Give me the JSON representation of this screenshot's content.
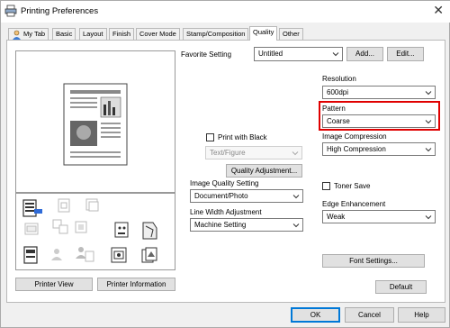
{
  "window": {
    "title": "Printing Preferences",
    "close_glyph": "✕"
  },
  "tabs": [
    {
      "label": "My Tab"
    },
    {
      "label": "Basic"
    },
    {
      "label": "Layout"
    },
    {
      "label": "Finish"
    },
    {
      "label": "Cover Mode"
    },
    {
      "label": "Stamp/Composition"
    },
    {
      "label": "Quality"
    },
    {
      "label": "Other"
    }
  ],
  "favorite": {
    "label": "Favorite Setting",
    "value": "Untitled",
    "add_label": "Add...",
    "edit_label": "Edit..."
  },
  "left": {
    "printer_view_label": "Printer View",
    "printer_info_label": "Printer Information"
  },
  "middle": {
    "print_black_label": "Print with Black",
    "text_figure_value": "Text/Figure",
    "quality_adjust_label": "Quality Adjustment...",
    "image_quality_label": "Image Quality Setting",
    "image_quality_value": "Document/Photo",
    "line_width_label": "Line Width Adjustment",
    "line_width_value": "Machine Setting"
  },
  "right": {
    "resolution_label": "Resolution",
    "resolution_value": "600dpi",
    "pattern_label": "Pattern",
    "pattern_value": "Coarse",
    "image_compression_label": "Image Compression",
    "image_compression_value": "High Compression",
    "toner_save_label": "Toner Save",
    "edge_label": "Edge Enhancement",
    "edge_value": "Weak",
    "font_settings_label": "Font Settings...",
    "default_label": "Default"
  },
  "footer": {
    "ok_label": "OK",
    "cancel_label": "Cancel",
    "help_label": "Help"
  },
  "colors": {
    "highlight": "#e00000",
    "accent": "#0078d7"
  }
}
